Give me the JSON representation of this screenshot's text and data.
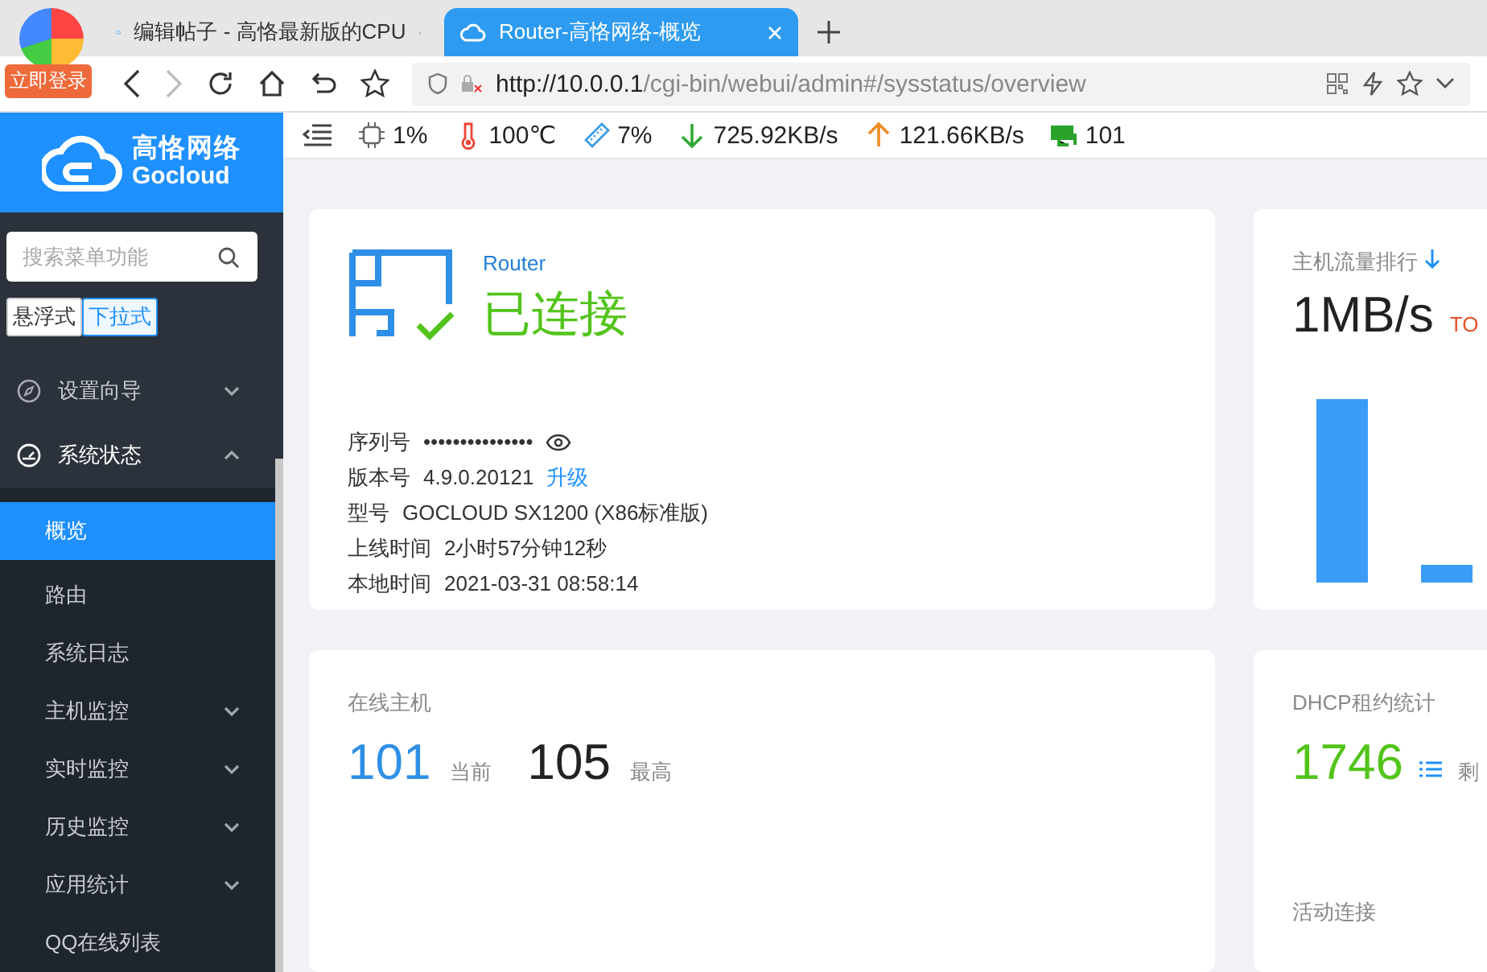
{
  "browser": {
    "tabs": [
      {
        "title": "编辑帖子 - 高恪最新版的CPU",
        "selected": false
      },
      {
        "title": "Router-高恪网络-概览",
        "selected": true
      }
    ],
    "login_badge": "立即登录",
    "url": {
      "host": "http://10.0.0.1",
      "path": "/cgi-bin/webui/admin#/sysstatus/overview"
    }
  },
  "brand": {
    "name": "高恪网络",
    "subtitle": "Gocloud"
  },
  "status_items": [
    {
      "kind": "cpu",
      "value": "1%"
    },
    {
      "kind": "temperature",
      "value": "100℃"
    },
    {
      "kind": "memory",
      "value": "7%"
    },
    {
      "kind": "download",
      "value": "725.92KB/s"
    },
    {
      "kind": "upload",
      "value": "121.66KB/s"
    },
    {
      "kind": "hosts",
      "value": "101"
    }
  ],
  "sidebar": {
    "search": {
      "placeholder": "搜索菜单功能"
    },
    "modes": [
      {
        "label": "悬浮式",
        "selected": false
      },
      {
        "label": "下拉式",
        "selected": true
      }
    ],
    "menu": [
      {
        "kind": "wizard",
        "label": "设置向导",
        "expanded": false
      },
      {
        "kind": "status",
        "label": "系统状态",
        "expanded": true,
        "children": [
          {
            "label": "概览",
            "selected": true
          },
          {
            "label": "路由",
            "selected": false
          },
          {
            "label": "系统日志",
            "selected": false
          },
          {
            "label": "主机监控",
            "selected": false,
            "expanded": false
          },
          {
            "label": "实时监控",
            "selected": false,
            "expanded": false
          },
          {
            "label": "历史监控",
            "selected": false,
            "expanded": false
          },
          {
            "label": "应用统计",
            "selected": false,
            "expanded": false
          },
          {
            "label": "QQ在线列表",
            "selected": false
          }
        ]
      }
    ]
  },
  "device": {
    "name": "Router",
    "status": "已连接",
    "connected": true,
    "fields": [
      {
        "kind": "secret",
        "label": "序列号",
        "value": "•••••••••••••••"
      },
      {
        "kind": "link",
        "label": "版本号",
        "value": "4.9.0.20121",
        "link": "升级"
      },
      {
        "kind": "plain",
        "label": "型号",
        "value": "GOCLOUD SX1200 (X86标准版)"
      },
      {
        "kind": "plain",
        "label": "上线时间",
        "value": "2小时57分钟12秒"
      },
      {
        "kind": "plain",
        "label": "本地时间",
        "value": "2021-03-31 08:58:14"
      }
    ]
  },
  "traffic": {
    "title": "主机流量排行",
    "value": "1MB/s",
    "tag": "TO"
  },
  "hosts": {
    "title": "在线主机",
    "current": "101",
    "current_label": "当前",
    "peak": "105",
    "peak_label": "最高"
  },
  "dhcp": {
    "title": "DHCP租约统计",
    "value": "1746",
    "note": "剩",
    "next_title": "活动连接"
  }
}
